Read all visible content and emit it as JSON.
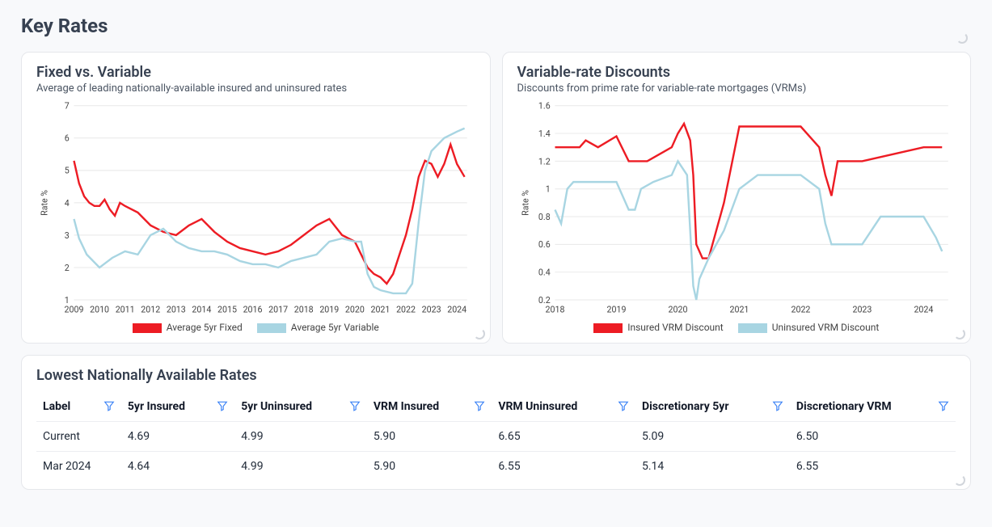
{
  "page": {
    "title": "Key Rates"
  },
  "card_fv": {
    "title": "Fixed vs. Variable",
    "subtitle": "Average of leading nationally-available insured and uninsured rates",
    "yaxis": "Rate %",
    "legend": {
      "fixed": "Average 5yr Fixed",
      "variable": "Average 5yr Variable"
    }
  },
  "card_vrm": {
    "title": "Variable-rate Discounts",
    "subtitle": "Discounts from prime rate for variable-rate mortgages (VRMs)",
    "yaxis": "Rate %",
    "legend": {
      "insured": "Insured VRM Discount",
      "uninsured": "Uninsured VRM Discount"
    }
  },
  "card_table": {
    "title": "Lowest Nationally Available Rates",
    "columns": {
      "label": "Label",
      "fyr_insured": "5yr Insured",
      "fyr_uninsured": "5yr Uninsured",
      "vrm_insured": "VRM Insured",
      "vrm_uninsured": "VRM Uninsured",
      "disc_5yr": "Discretionary 5yr",
      "disc_vrm": "Discretionary VRM"
    },
    "rows": [
      {
        "label": "Current",
        "fyr_insured": "4.69",
        "fyr_uninsured": "4.99",
        "vrm_insured": "5.90",
        "vrm_uninsured": "6.65",
        "disc_5yr": "5.09",
        "disc_vrm": "6.50"
      },
      {
        "label": "Mar 2024",
        "fyr_insured": "4.64",
        "fyr_uninsured": "4.99",
        "vrm_insured": "5.90",
        "vrm_uninsured": "6.55",
        "disc_5yr": "5.14",
        "disc_vrm": "6.55"
      }
    ]
  },
  "chart_data": [
    {
      "id": "fixed_vs_variable",
      "type": "line",
      "xlabel": "",
      "ylabel": "Rate %",
      "xlim": [
        2009,
        2024.4
      ],
      "ylim": [
        1,
        7
      ],
      "xticks": [
        2009,
        2010,
        2011,
        2012,
        2013,
        2014,
        2015,
        2016,
        2017,
        2018,
        2019,
        2020,
        2021,
        2022,
        2023,
        2024
      ],
      "yticks": [
        1,
        2,
        3,
        4,
        5,
        6,
        7
      ],
      "series": [
        {
          "name": "Average 5yr Fixed",
          "color": "#ed1c24",
          "x": [
            2009.0,
            2009.2,
            2009.4,
            2009.6,
            2009.8,
            2010.0,
            2010.2,
            2010.4,
            2010.6,
            2010.8,
            2011.0,
            2011.5,
            2012.0,
            2012.5,
            2013.0,
            2013.5,
            2014.0,
            2014.5,
            2015.0,
            2015.5,
            2016.0,
            2016.5,
            2017.0,
            2017.5,
            2018.0,
            2018.5,
            2019.0,
            2019.5,
            2020.0,
            2020.25,
            2020.5,
            2020.75,
            2021.0,
            2021.25,
            2021.5,
            2021.75,
            2022.0,
            2022.25,
            2022.5,
            2022.75,
            2023.0,
            2023.25,
            2023.5,
            2023.75,
            2024.0,
            2024.3
          ],
          "y": [
            5.3,
            4.6,
            4.2,
            4.0,
            3.9,
            3.9,
            4.1,
            3.8,
            3.6,
            4.0,
            3.9,
            3.7,
            3.3,
            3.1,
            3.0,
            3.3,
            3.5,
            3.1,
            2.8,
            2.6,
            2.5,
            2.4,
            2.5,
            2.7,
            3.0,
            3.3,
            3.5,
            3.0,
            2.8,
            2.4,
            2.0,
            1.8,
            1.7,
            1.5,
            1.8,
            2.4,
            3.0,
            3.8,
            4.8,
            5.3,
            5.2,
            4.8,
            5.2,
            5.8,
            5.2,
            4.8
          ]
        },
        {
          "name": "Average 5yr Variable",
          "color": "#a8d5e2",
          "x": [
            2009.0,
            2009.2,
            2009.5,
            2010.0,
            2010.5,
            2011.0,
            2011.5,
            2012.0,
            2012.5,
            2013.0,
            2013.5,
            2014.0,
            2014.5,
            2015.0,
            2015.5,
            2016.0,
            2016.5,
            2017.0,
            2017.5,
            2018.0,
            2018.5,
            2019.0,
            2019.5,
            2020.0,
            2020.25,
            2020.5,
            2020.75,
            2021.0,
            2021.5,
            2021.75,
            2022.0,
            2022.25,
            2022.5,
            2022.75,
            2023.0,
            2023.5,
            2024.0,
            2024.3
          ],
          "y": [
            3.5,
            2.9,
            2.4,
            2.0,
            2.3,
            2.5,
            2.4,
            3.0,
            3.2,
            2.8,
            2.6,
            2.5,
            2.5,
            2.4,
            2.2,
            2.1,
            2.1,
            2.0,
            2.2,
            2.3,
            2.4,
            2.8,
            2.9,
            2.8,
            2.8,
            1.8,
            1.4,
            1.3,
            1.2,
            1.2,
            1.2,
            1.5,
            3.4,
            5.0,
            5.6,
            6.0,
            6.2,
            6.3
          ]
        }
      ]
    },
    {
      "id": "vrm_discounts",
      "type": "line",
      "xlabel": "",
      "ylabel": "Rate %",
      "xlim": [
        2018,
        2024.4
      ],
      "ylim": [
        0.2,
        1.6
      ],
      "xticks": [
        2018,
        2019,
        2020,
        2021,
        2022,
        2023,
        2024
      ],
      "yticks": [
        0.2,
        0.4,
        0.6,
        0.8,
        1.0,
        1.2,
        1.4,
        1.6
      ],
      "series": [
        {
          "name": "Insured VRM Discount",
          "color": "#ed1c24",
          "x": [
            2018.0,
            2018.4,
            2018.5,
            2018.7,
            2019.0,
            2019.2,
            2019.3,
            2019.5,
            2019.7,
            2019.9,
            2020.0,
            2020.1,
            2020.2,
            2020.25,
            2020.3,
            2020.4,
            2020.5,
            2020.75,
            2021.0,
            2022.0,
            2022.3,
            2022.4,
            2022.5,
            2022.6,
            2022.7,
            2023.0,
            2023.5,
            2024.0,
            2024.3
          ],
          "y": [
            1.3,
            1.3,
            1.35,
            1.3,
            1.38,
            1.2,
            1.2,
            1.2,
            1.25,
            1.3,
            1.4,
            1.47,
            1.35,
            1.1,
            0.6,
            0.5,
            0.5,
            0.9,
            1.45,
            1.45,
            1.3,
            1.1,
            0.95,
            1.2,
            1.2,
            1.2,
            1.25,
            1.3,
            1.3
          ]
        },
        {
          "name": "Uninsured VRM Discount",
          "color": "#a8d5e2",
          "x": [
            2018.0,
            2018.1,
            2018.2,
            2018.3,
            2018.6,
            2019.0,
            2019.2,
            2019.3,
            2019.4,
            2019.6,
            2019.9,
            2020.0,
            2020.15,
            2020.2,
            2020.25,
            2020.3,
            2020.35,
            2020.5,
            2020.75,
            2021.0,
            2021.3,
            2021.7,
            2022.0,
            2022.3,
            2022.4,
            2022.5,
            2022.6,
            2022.7,
            2023.0,
            2023.3,
            2023.5,
            2024.0,
            2024.2,
            2024.3
          ],
          "y": [
            0.85,
            0.75,
            1.0,
            1.05,
            1.05,
            1.05,
            0.85,
            0.85,
            1.0,
            1.05,
            1.1,
            1.2,
            1.1,
            0.7,
            0.3,
            0.2,
            0.35,
            0.5,
            0.7,
            1.0,
            1.1,
            1.1,
            1.1,
            1.0,
            0.75,
            0.6,
            0.6,
            0.6,
            0.6,
            0.8,
            0.8,
            0.8,
            0.65,
            0.55
          ]
        }
      ]
    }
  ]
}
